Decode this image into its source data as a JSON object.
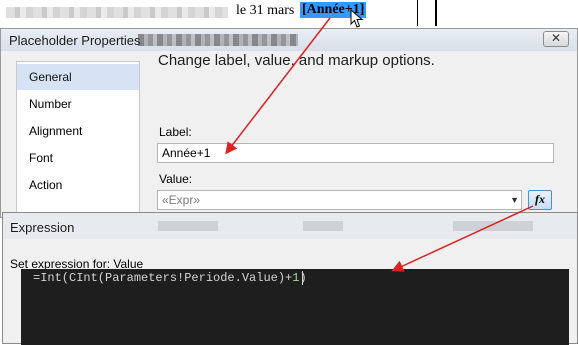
{
  "report": {
    "date_text": "le 31 mars",
    "placeholder_text": "[Année+1]"
  },
  "placeholder_dialog": {
    "title": "Placeholder Properties",
    "close_glyph": "✕",
    "nav_items": [
      {
        "label": "General",
        "selected": true
      },
      {
        "label": "Number",
        "selected": false
      },
      {
        "label": "Alignment",
        "selected": false
      },
      {
        "label": "Font",
        "selected": false
      },
      {
        "label": "Action",
        "selected": false
      }
    ],
    "heading": "Change label, value, and markup options.",
    "label_caption": "Label:",
    "label_value": "Année+1",
    "value_caption": "Value:",
    "value_placeholder": "«Expr»",
    "fx_button": "fx"
  },
  "expression_dialog": {
    "title": "Expression",
    "set_expression_label": "Set expression for: Value",
    "code_prefix": "=Int(CInt(Parameters!Periode.Value)+",
    "code_number": "1",
    "code_suffix": ")"
  },
  "colors": {
    "placeholder_highlight": "#3399ff",
    "nav_selected": "#d6e3f5",
    "editor_background": "#1e1e1e",
    "arrow": "#e02020"
  }
}
